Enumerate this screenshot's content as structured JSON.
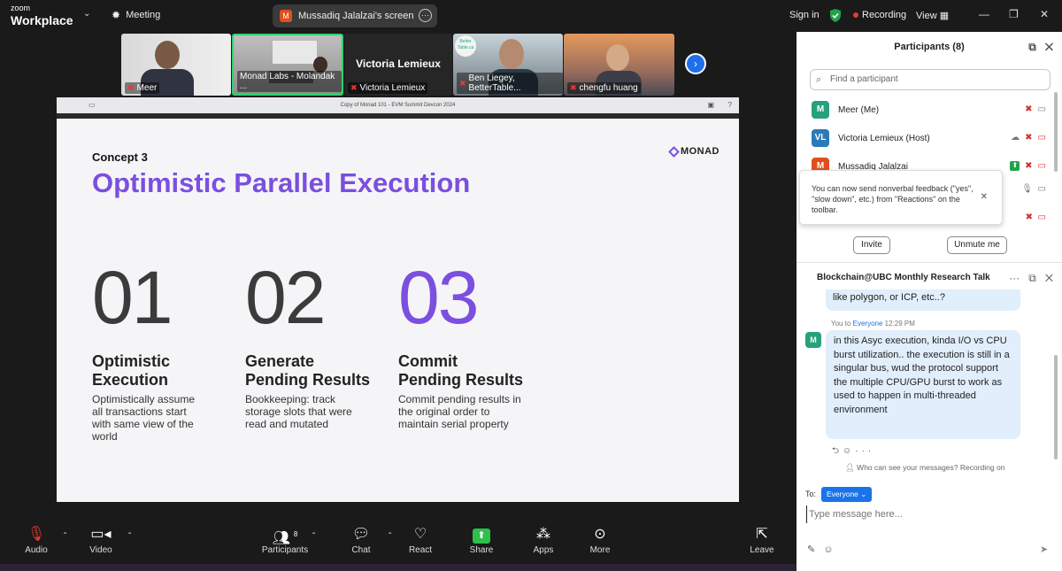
{
  "app": {
    "brand_small": "zoom",
    "brand_large": "Workplace",
    "meeting_label": "Meeting",
    "share_title": "Mussadiq Jalalzai's screen",
    "share_badge": "M",
    "sign_in": "Sign in",
    "recording": "Recording",
    "view": "View"
  },
  "thumbnails": [
    {
      "name": "Meer"
    },
    {
      "name": "Monad Labs - Molandak ..."
    },
    {
      "name": "Victoria Lemieux",
      "big_name": "Victoria Lemieux"
    },
    {
      "name": "Ben Liegey, BetterTable...",
      "logo": "Better Table.ca"
    },
    {
      "name": "chengfu huang"
    }
  ],
  "screen": {
    "window_title": "Copy of Monad 101 - EVM Summit Devcon 2024"
  },
  "slide": {
    "concept": "Concept 3",
    "title": "Optimistic Parallel Execution",
    "logo": "MONAD",
    "columns": [
      {
        "num": "01",
        "heading_1": "Optimistic",
        "heading_2": "Execution",
        "desc": "Optimistically assume all transactions start with same view of the world"
      },
      {
        "num": "02",
        "heading_1": "Generate",
        "heading_2": "Pending Results",
        "desc": "Bookkeeping: track storage slots that were read and mutated"
      },
      {
        "num": "03",
        "heading_1": "Commit",
        "heading_2": "Pending Results",
        "desc": "Commit pending results in the original order to maintain serial property"
      }
    ]
  },
  "toolbar": {
    "audio": "Audio",
    "video": "Video",
    "participants": "Participants",
    "participants_count": "8",
    "chat": "Chat",
    "react": "React",
    "share": "Share",
    "apps": "Apps",
    "more": "More",
    "leave": "Leave"
  },
  "participants_panel": {
    "title": "Participants (8)",
    "search_placeholder": "Find a participant",
    "list": [
      {
        "initials": "M",
        "name": "Meer (Me)",
        "color": "#26a17b"
      },
      {
        "initials": "VL",
        "name": "Victoria Lemieux (Host)",
        "color": "#2b7bb9"
      },
      {
        "initials": "M",
        "name": "Mussadiq Jalalzai",
        "color": "#e0501e"
      }
    ],
    "tooltip": "You can now send nonverbal feedback (\"yes\", \"slow down\", etc.) from \"Reactions\" on the toolbar.",
    "invite": "Invite",
    "unmute": "Unmute me"
  },
  "chat_panel": {
    "title": "Blockchain@UBC Monthly Research Talk",
    "prev_message": "like polygon, or ICP, etc..?",
    "meta_prefix": "You to",
    "meta_target": "Everyone",
    "meta_time": "12:29 PM",
    "avatar": "M",
    "message": "in this Asyc execution, kinda I/O vs CPU burst utilization.. the execution is still in a singular bus, wud the protocol support the multiple CPU/GPU burst to work as used to happen in multi-threaded environment",
    "who_can_see": "Who can see your messages? Recording on",
    "to_label": "To:",
    "to_value": "Everyone",
    "input_placeholder": "Type message here..."
  },
  "colors": {
    "accent_purple": "#7b4fe0",
    "zoom_blue": "#1a73e8",
    "share_green": "#2fbf4d",
    "mute_red": "#e53935"
  }
}
